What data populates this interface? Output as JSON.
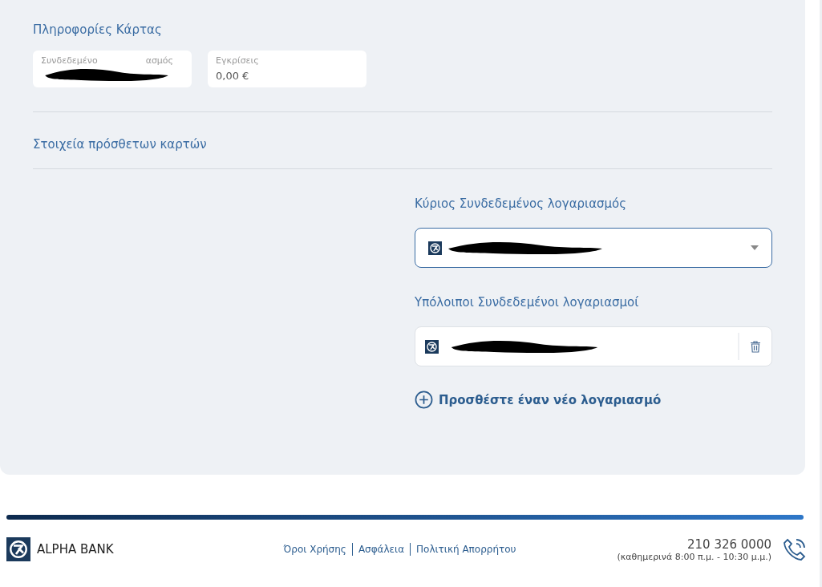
{
  "card_info": {
    "title": "Πληροφορίες Κάρτας",
    "fields": [
      {
        "kind": "redacted",
        "label_start": "Συνδεδεμένο",
        "label_end": "ασμός"
      },
      {
        "kind": "plain",
        "label": "Εγκρίσεις",
        "value": "0,00 €"
      }
    ]
  },
  "additional": {
    "title": "Στοιχεία πρόσθετων καρτών"
  },
  "accounts": {
    "primary_label": "Κύριος Συνδεδεμένος λογαριασμός",
    "other_label": "Υπόλοιποι Συνδεδεμένοι λογαριασμοί",
    "add_link": "Προσθέστε έναν νέο λογαριασμό"
  },
  "footer": {
    "brand": "ALPHA BANK",
    "links": [
      "Όροι Χρήσης",
      "Ασφάλεια",
      "Πολιτική Απορρήτου"
    ],
    "phone": "210 326 0000",
    "hours": "(καθημερινά 8:00 π.μ. - 10:30 μ.μ.)"
  }
}
